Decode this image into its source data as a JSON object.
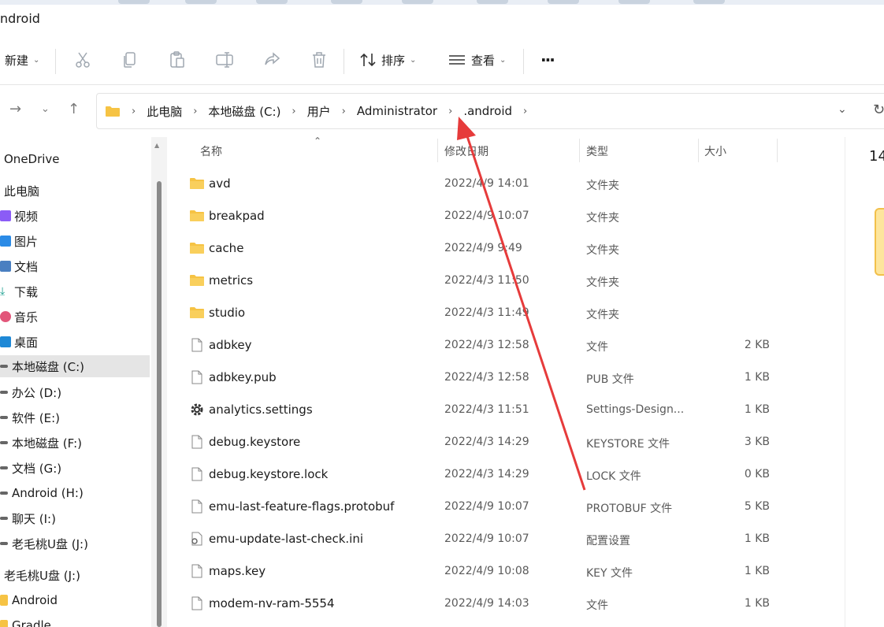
{
  "window": {
    "title": "ndroid"
  },
  "toolbar": {
    "new_label": "新建",
    "sort_label": "排序",
    "view_label": "查看",
    "more_label": "···",
    "icons": [
      "cut-icon",
      "copy-icon",
      "paste-icon",
      "rename-icon",
      "share-icon",
      "delete-icon"
    ]
  },
  "breadcrumb": [
    "此电脑",
    "本地磁盘 (C:)",
    "用户",
    "Administrator",
    ".android"
  ],
  "sidebar": {
    "items": [
      {
        "label": "OneDrive",
        "icon": "cloud-icon"
      },
      {
        "label": "此电脑",
        "icon": "computer-icon"
      },
      {
        "label": "视频",
        "icon": "video-icon"
      },
      {
        "label": "图片",
        "icon": "picture-icon"
      },
      {
        "label": "文档",
        "icon": "document-icon"
      },
      {
        "label": "下载",
        "icon": "download-icon"
      },
      {
        "label": "音乐",
        "icon": "music-icon"
      },
      {
        "label": "桌面",
        "icon": "desktop-icon"
      },
      {
        "label": "本地磁盘 (C:)",
        "icon": "drive-icon",
        "selected": true
      },
      {
        "label": "办公 (D:)",
        "icon": "drive-icon"
      },
      {
        "label": "软件 (E:)",
        "icon": "drive-icon"
      },
      {
        "label": "本地磁盘 (F:)",
        "icon": "drive-icon"
      },
      {
        "label": "文档 (G:)",
        "icon": "drive-icon"
      },
      {
        "label": "Android (H:)",
        "icon": "drive-icon"
      },
      {
        "label": "聊天 (I:)",
        "icon": "drive-icon"
      },
      {
        "label": "老毛桃U盘 (J:)",
        "icon": "drive-icon"
      },
      {
        "label": "老毛桃U盘 (J:)",
        "icon": "usb-icon"
      },
      {
        "label": "Android",
        "icon": "folder-icon"
      },
      {
        "label": "Gradle",
        "icon": "folder-icon"
      }
    ]
  },
  "columns": {
    "name": "名称",
    "date": "修改日期",
    "type": "类型",
    "size": "大小"
  },
  "files": [
    {
      "name": "avd",
      "date": "2022/4/9 14:01",
      "type": "文件夹",
      "size": "",
      "kind": "folder"
    },
    {
      "name": "breakpad",
      "date": "2022/4/9 10:07",
      "type": "文件夹",
      "size": "",
      "kind": "folder"
    },
    {
      "name": "cache",
      "date": "2022/4/9 9:49",
      "type": "文件夹",
      "size": "",
      "kind": "folder"
    },
    {
      "name": "metrics",
      "date": "2022/4/3 11:50",
      "type": "文件夹",
      "size": "",
      "kind": "folder"
    },
    {
      "name": "studio",
      "date": "2022/4/3 11:49",
      "type": "文件夹",
      "size": "",
      "kind": "folder"
    },
    {
      "name": "adbkey",
      "date": "2022/4/3 12:58",
      "type": "文件",
      "size": "2 KB",
      "kind": "file"
    },
    {
      "name": "adbkey.pub",
      "date": "2022/4/3 12:58",
      "type": "PUB 文件",
      "size": "1 KB",
      "kind": "file"
    },
    {
      "name": "analytics.settings",
      "date": "2022/4/3 11:51",
      "type": "Settings-Design...",
      "size": "1 KB",
      "kind": "settings"
    },
    {
      "name": "debug.keystore",
      "date": "2022/4/3 14:29",
      "type": "KEYSTORE 文件",
      "size": "3 KB",
      "kind": "file"
    },
    {
      "name": "debug.keystore.lock",
      "date": "2022/4/3 14:29",
      "type": "LOCK 文件",
      "size": "0 KB",
      "kind": "file"
    },
    {
      "name": "emu-last-feature-flags.protobuf",
      "date": "2022/4/9 10:07",
      "type": "PROTOBUF 文件",
      "size": "5 KB",
      "kind": "file"
    },
    {
      "name": "emu-update-last-check.ini",
      "date": "2022/4/9 10:07",
      "type": "配置设置",
      "size": "1 KB",
      "kind": "ini"
    },
    {
      "name": "maps.key",
      "date": "2022/4/9 10:08",
      "type": "KEY 文件",
      "size": "1 KB",
      "kind": "file"
    },
    {
      "name": "modem-nv-ram-5554",
      "date": "2022/4/9 14:03",
      "type": "文件",
      "size": "1 KB",
      "kind": "file"
    }
  ],
  "preview": {
    "count_text": "14"
  },
  "colors": {
    "folder": "#f6c344",
    "selection": "#e5e5e5",
    "annotation": "#e63b3b"
  }
}
